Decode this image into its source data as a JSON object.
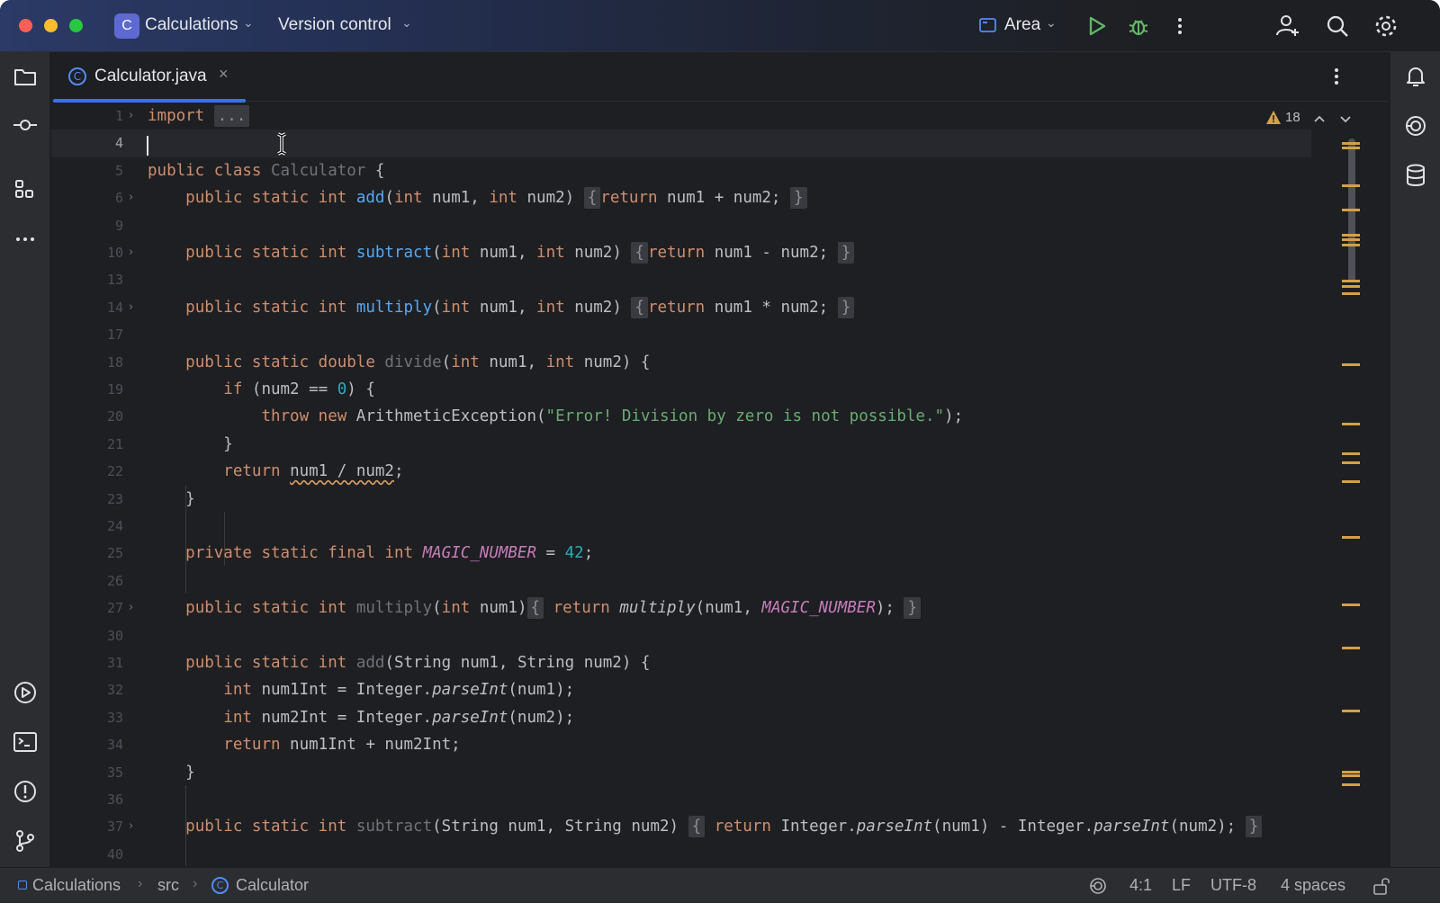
{
  "titlebar": {
    "project_badge": "C",
    "project_name": "Calculations",
    "vcs_label": "Version control",
    "run_config": "Area"
  },
  "tab": {
    "icon_letter": "C",
    "label": "Calculator.java",
    "close": "×"
  },
  "inspections": {
    "warning_count": "18"
  },
  "editor": {
    "lines": [
      {
        "n": "1",
        "fold": true
      },
      {
        "n": "4",
        "current": true
      },
      {
        "n": "5"
      },
      {
        "n": "6",
        "fold": true
      },
      {
        "n": "9"
      },
      {
        "n": "10",
        "fold": true
      },
      {
        "n": "13"
      },
      {
        "n": "14",
        "fold": true
      },
      {
        "n": "17"
      },
      {
        "n": "18"
      },
      {
        "n": "19"
      },
      {
        "n": "20"
      },
      {
        "n": "21"
      },
      {
        "n": "22"
      },
      {
        "n": "23"
      },
      {
        "n": "24"
      },
      {
        "n": "25"
      },
      {
        "n": "26"
      },
      {
        "n": "27",
        "fold": true
      },
      {
        "n": "30"
      },
      {
        "n": "31"
      },
      {
        "n": "32"
      },
      {
        "n": "33"
      },
      {
        "n": "34"
      },
      {
        "n": "35"
      },
      {
        "n": "36"
      },
      {
        "n": "37",
        "fold": true
      },
      {
        "n": "40"
      }
    ],
    "code": {
      "l1_import": "import",
      "l1_folded": "...",
      "l5_public_class": "public class",
      "l5_classname": "Calculator",
      "l5_brace": " {",
      "mod_psi": "public static int",
      "mod_psd": "public static double",
      "mod_psfi": "private static final int",
      "add": "add",
      "subtract": "subtract",
      "multiply": "multiply",
      "divide": "divide",
      "params_2int_open": "(",
      "int_kw": "int",
      "num1": " num1, ",
      "num2_close": " num2)",
      "fold_open": "{",
      "fold_close": "}",
      "return_kw": "return",
      "expr_add": " num1 + num2; ",
      "expr_sub": " num1 - num2; ",
      "expr_mul": " num1 * num2; ",
      "l18_rest_open": "(",
      "l18_rest_close": " num2) {",
      "l19_if": "if",
      "l19_mid": " (num2 == ",
      "l19_zero": "0",
      "l19_end": ") {",
      "l20_throw": "throw new",
      "l20_exc": " ArithmeticException(",
      "l20_str": "\"Error! Division by zero is not possible.\"",
      "l20_end": ");",
      "l21": "}",
      "l22_expr": "num1 / num2",
      "l22_end": ";",
      "l23": "}",
      "l25_const": "MAGIC_NUMBER",
      "l25_eq": " = ",
      "l25_val": "42",
      "l25_end": ";",
      "l27_params": "(",
      "l27_p_end": " num1)",
      "l27_call": "multiply",
      "l27_args_open": "(num1, ",
      "l27_const": "MAGIC_NUMBER",
      "l27_args_close": "); ",
      "l31_params": "(String num1, String num2) {",
      "l32_decl": " num1Int = Integer.",
      "parseInt": "parseInt",
      "l32_end": "(num1);",
      "l33_decl": " num2Int = Integer.",
      "l33_end": "(num2);",
      "l34_expr": " num1Int + num2Int;",
      "l35": "}",
      "l37_params": "(String num1, String num2)",
      "l37_mid1": " Integer.",
      "l37_mid2": "(num1) - Integer.",
      "l37_end": "(num2); "
    }
  },
  "statusbar": {
    "breadcrumb_project": "Calculations",
    "breadcrumb_sep": "›",
    "breadcrumb_dir": "src",
    "breadcrumb_class": "Calculator",
    "breadcrumb_class_icon": "C",
    "position": "4:1",
    "line_ending": "LF",
    "encoding": "UTF-8",
    "indent": "4 spaces"
  },
  "colors": {
    "editor_bg": "#1e1f22",
    "keyword": "#cf8e6d",
    "function": "#56a8f5",
    "string": "#6aab73",
    "number": "#2aacb8",
    "constant": "#c77dbb",
    "accent": "#3574f0",
    "warning": "#d5a046"
  }
}
